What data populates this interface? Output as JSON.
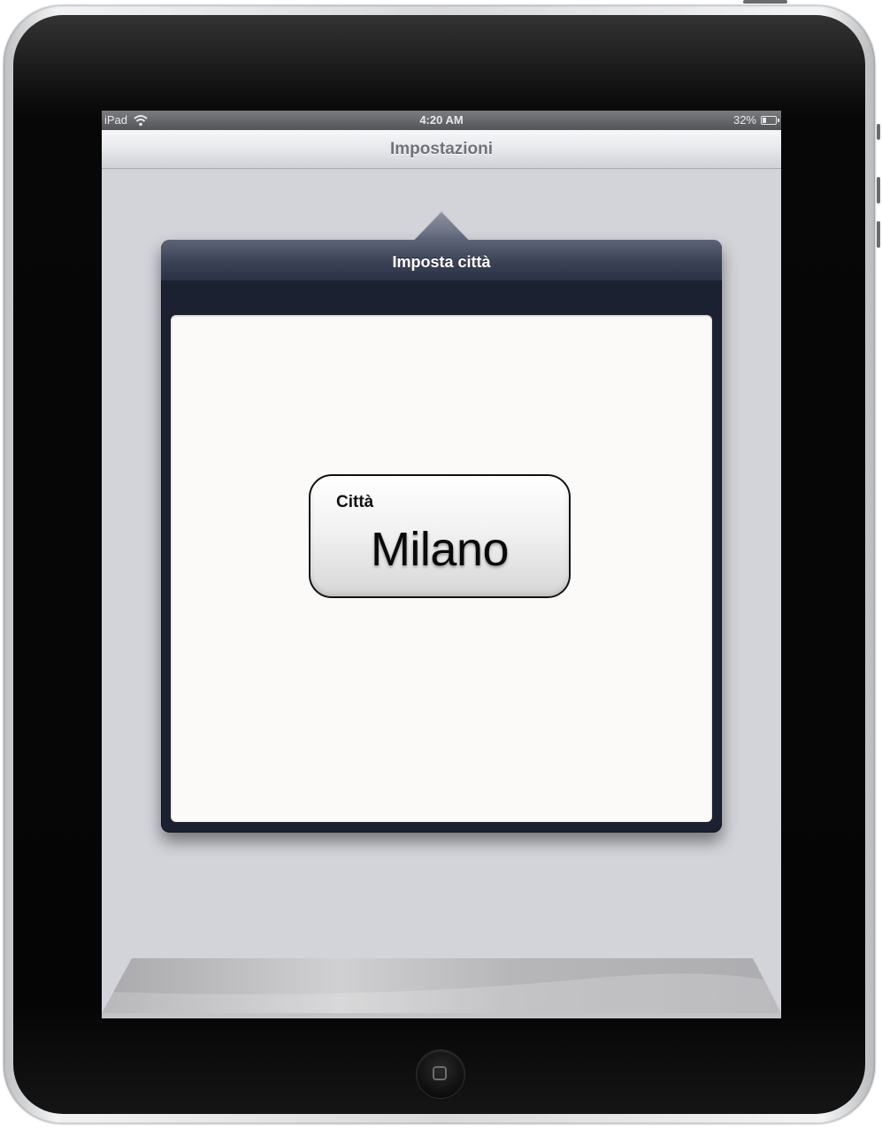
{
  "statusbar": {
    "carrier": "iPad",
    "time": "4:20 AM",
    "battery_percent": "32%",
    "battery_level": 0.32,
    "wifi_icon": "wifi-icon",
    "battery_icon": "battery-icon"
  },
  "navbar": {
    "title": "Impostazioni"
  },
  "popover": {
    "title": "Imposta città"
  },
  "city": {
    "label": "Città",
    "value": "Milano"
  },
  "device": {
    "home_button_icon": "home-square-icon"
  }
}
